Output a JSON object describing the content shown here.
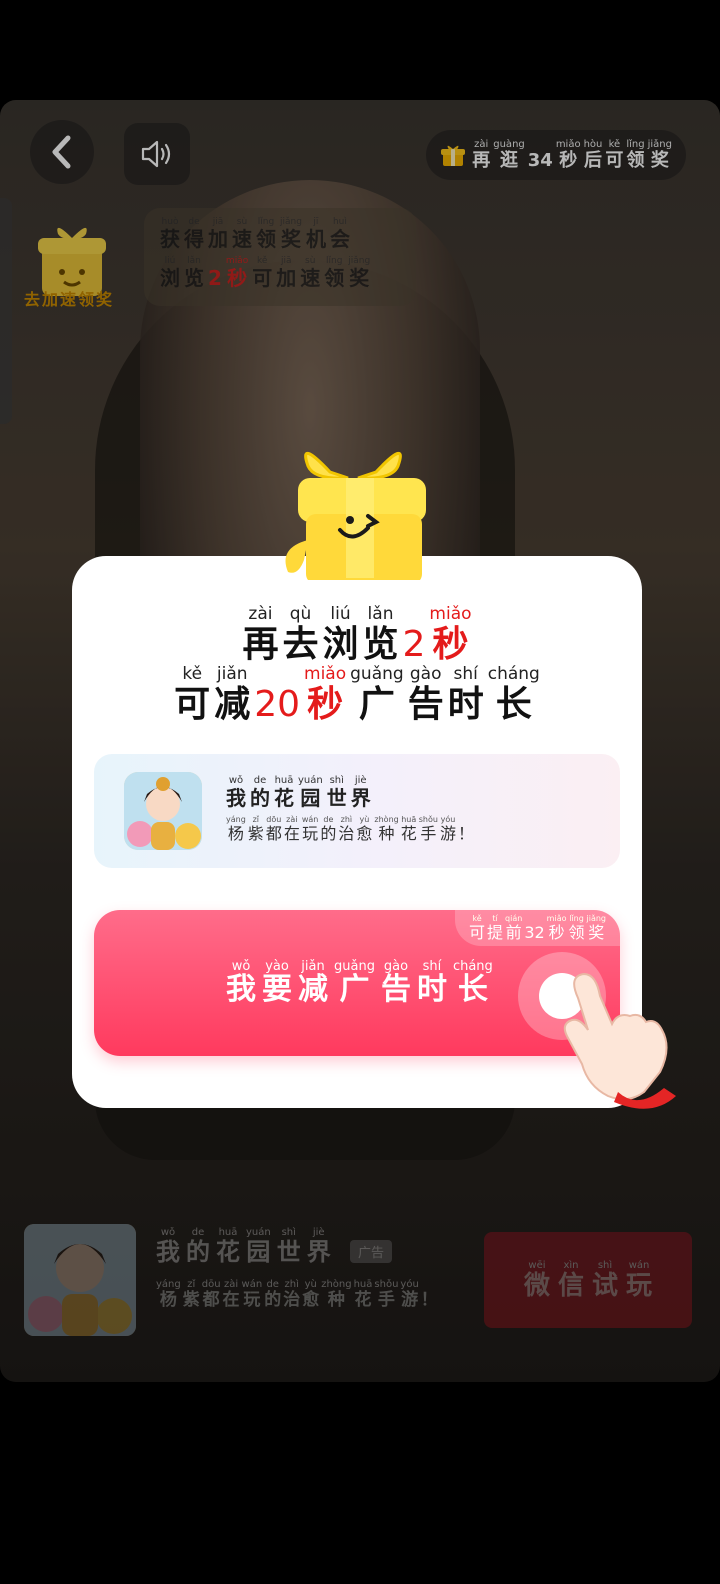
{
  "top_bar": {
    "back_icon": "chevron-left-icon",
    "sound_icon": "speaker-icon",
    "gift_icon": "gift-icon",
    "countdown": [
      {
        "p": "zài",
        "h": "再"
      },
      {
        "p": "guàng",
        "h": "逛"
      },
      {
        "p": "",
        "h": "34"
      },
      {
        "p": "miǎo",
        "h": "秒"
      },
      {
        "p": "hòu",
        "h": "后"
      },
      {
        "p": "kě",
        "h": "可"
      },
      {
        "p": "lǐng",
        "h": "领"
      },
      {
        "p": "jiǎng",
        "h": "奖"
      }
    ]
  },
  "side_badge": {
    "label": "去加速领奖"
  },
  "speed_tip": {
    "line1": [
      {
        "p": "huò",
        "h": "获"
      },
      {
        "p": "de",
        "h": "得"
      },
      {
        "p": "jiā",
        "h": "加"
      },
      {
        "p": "sù",
        "h": "速"
      },
      {
        "p": "lǐng",
        "h": "领"
      },
      {
        "p": "jiǎng",
        "h": "奖"
      },
      {
        "p": "jī",
        "h": "机"
      },
      {
        "p": "huì",
        "h": "会"
      }
    ],
    "line2": [
      {
        "p": "liú",
        "h": "浏"
      },
      {
        "p": "lǎn",
        "h": "览"
      },
      {
        "p": "",
        "h": "2",
        "red": true
      },
      {
        "p": "miǎo",
        "h": "秒",
        "red": true
      },
      {
        "p": "kě",
        "h": "可"
      },
      {
        "p": "jiā",
        "h": "加"
      },
      {
        "p": "sù",
        "h": "速"
      },
      {
        "p": "lǐng",
        "h": "领"
      },
      {
        "p": "jiǎng",
        "h": "奖"
      }
    ]
  },
  "modal": {
    "headline1": [
      {
        "p": "zài",
        "h": "再"
      },
      {
        "p": "qù",
        "h": "去"
      },
      {
        "p": "liú",
        "h": "浏"
      },
      {
        "p": "lǎn",
        "h": "览"
      },
      {
        "p": "",
        "h": "2",
        "num": true
      },
      {
        "p": "miǎo",
        "h": "秒",
        "red": true
      }
    ],
    "headline2": [
      {
        "p": "kě",
        "h": "可"
      },
      {
        "p": "jiǎn",
        "h": "减"
      },
      {
        "p": "",
        "h": "20",
        "num": true
      },
      {
        "p": "miǎo",
        "h": "秒",
        "red": true
      },
      {
        "p": "guǎng",
        "h": "广"
      },
      {
        "p": "gào",
        "h": "告"
      },
      {
        "p": "shí",
        "h": "时"
      },
      {
        "p": "cháng",
        "h": "长"
      }
    ],
    "app": {
      "name": [
        {
          "p": "wǒ",
          "h": "我"
        },
        {
          "p": "de",
          "h": "的"
        },
        {
          "p": "huā",
          "h": "花"
        },
        {
          "p": "yuán",
          "h": "园"
        },
        {
          "p": "shì",
          "h": "世"
        },
        {
          "p": "jiè",
          "h": "界"
        }
      ],
      "desc": [
        {
          "p": "yáng",
          "h": "杨"
        },
        {
          "p": "zǐ",
          "h": "紫"
        },
        {
          "p": "dōu",
          "h": "都"
        },
        {
          "p": "zài",
          "h": "在"
        },
        {
          "p": "wán",
          "h": "玩"
        },
        {
          "p": "de",
          "h": "的"
        },
        {
          "p": "zhì",
          "h": "治"
        },
        {
          "p": "yù",
          "h": "愈"
        },
        {
          "p": "zhòng",
          "h": "种"
        },
        {
          "p": "huā",
          "h": "花"
        },
        {
          "p": "shǒu",
          "h": "手"
        },
        {
          "p": "yóu",
          "h": "游"
        },
        {
          "p": "",
          "h": "！"
        }
      ]
    },
    "cta_tag": [
      {
        "p": "kě",
        "h": "可"
      },
      {
        "p": "tí",
        "h": "提"
      },
      {
        "p": "qián",
        "h": "前"
      },
      {
        "p": "",
        "h": "32"
      },
      {
        "p": "miǎo",
        "h": "秒"
      },
      {
        "p": "lǐng",
        "h": "领"
      },
      {
        "p": "jiǎng",
        "h": "奖"
      }
    ],
    "cta_label": [
      {
        "p": "wǒ",
        "h": "我"
      },
      {
        "p": "yào",
        "h": "要"
      },
      {
        "p": "jiǎn",
        "h": "减"
      },
      {
        "p": "guǎng",
        "h": "广"
      },
      {
        "p": "gào",
        "h": "告"
      },
      {
        "p": "shí",
        "h": "时"
      },
      {
        "p": "cháng",
        "h": "长"
      }
    ]
  },
  "ad_bar": {
    "name": [
      {
        "p": "wǒ",
        "h": "我"
      },
      {
        "p": "de",
        "h": "的"
      },
      {
        "p": "huā",
        "h": "花"
      },
      {
        "p": "yuán",
        "h": "园"
      },
      {
        "p": "shì",
        "h": "世"
      },
      {
        "p": "jiè",
        "h": "界"
      }
    ],
    "desc": [
      {
        "p": "yáng",
        "h": "杨"
      },
      {
        "p": "zǐ",
        "h": "紫"
      },
      {
        "p": "dōu",
        "h": "都"
      },
      {
        "p": "zài",
        "h": "在"
      },
      {
        "p": "wán",
        "h": "玩"
      },
      {
        "p": "de",
        "h": "的"
      },
      {
        "p": "zhì",
        "h": "治"
      },
      {
        "p": "yù",
        "h": "愈"
      },
      {
        "p": "zhòng",
        "h": "种"
      },
      {
        "p": "huā",
        "h": "花"
      },
      {
        "p": "shǒu",
        "h": "手"
      },
      {
        "p": "yóu",
        "h": "游"
      },
      {
        "p": "",
        "h": "！"
      }
    ],
    "tag": "广告",
    "button": [
      {
        "p": "wēi",
        "h": "微"
      },
      {
        "p": "xìn",
        "h": "信"
      },
      {
        "p": "shì",
        "h": "试"
      },
      {
        "p": "wán",
        "h": "玩"
      }
    ]
  },
  "colors": {
    "accent_red": "#e41b1b",
    "cta_pink": "#ff3a5e",
    "wechat_button": "#b01624"
  }
}
